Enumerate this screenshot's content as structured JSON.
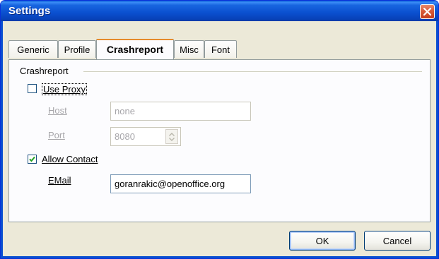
{
  "window": {
    "title": "Settings",
    "close_icon": "close-icon"
  },
  "tabs": [
    {
      "label": "Generic"
    },
    {
      "label": "Profile"
    },
    {
      "label": "Crashreport",
      "active": true
    },
    {
      "label": "Misc"
    },
    {
      "label": "Font"
    }
  ],
  "crashreport": {
    "group_label": "Crashreport",
    "use_proxy": {
      "label": "Use Proxy",
      "checked": false
    },
    "host": {
      "label": "Host",
      "value": "none",
      "disabled": true
    },
    "port": {
      "label": "Port",
      "value": "8080",
      "disabled": true
    },
    "allow_contact": {
      "label": "Allow Contact",
      "checked": true
    },
    "email": {
      "label": "EMail",
      "value": "goranrakic@openoffice.org"
    }
  },
  "buttons": {
    "ok": "OK",
    "cancel": "Cancel"
  },
  "colors": {
    "titlebar": "#0a4fcf",
    "dialog_bg": "#ece9d8",
    "active_tab_accent": "#e68b2c",
    "close_button": "#d85b3a"
  }
}
